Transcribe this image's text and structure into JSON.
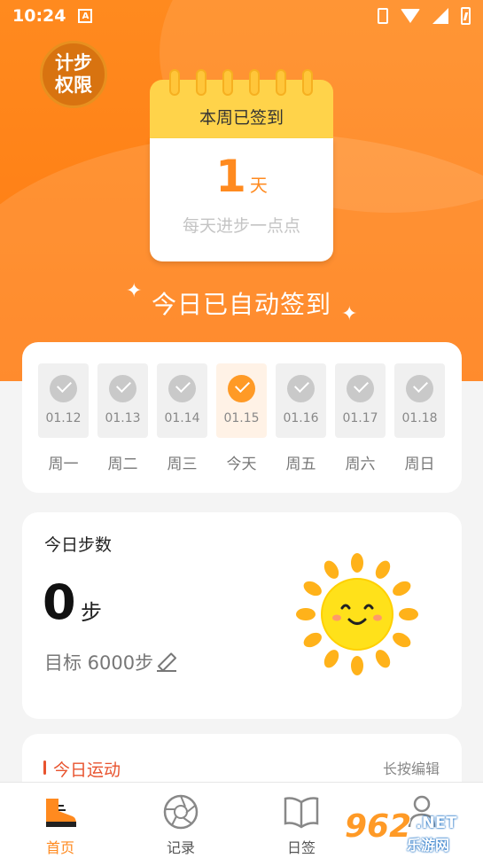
{
  "status_bar": {
    "time": "10:24",
    "notification_glyph": "A"
  },
  "permission_badge": {
    "label": "计步权限"
  },
  "calendar": {
    "title": "本周已签到",
    "days_count": "1",
    "days_unit": "天",
    "subtitle": "每天进步一点点"
  },
  "auto_checkin_text": "今日已自动签到",
  "week": {
    "days": [
      {
        "date": "01.12",
        "label": "周一",
        "checked": true,
        "today": false
      },
      {
        "date": "01.13",
        "label": "周二",
        "checked": true,
        "today": false
      },
      {
        "date": "01.14",
        "label": "周三",
        "checked": true,
        "today": false
      },
      {
        "date": "01.15",
        "label": "今天",
        "checked": true,
        "today": true
      },
      {
        "date": "01.16",
        "label": "周五",
        "checked": true,
        "today": false
      },
      {
        "date": "01.17",
        "label": "周六",
        "checked": true,
        "today": false
      },
      {
        "date": "01.18",
        "label": "周日",
        "checked": true,
        "today": false
      }
    ]
  },
  "steps": {
    "title": "今日步数",
    "count": "0",
    "unit": "步",
    "goal_text": "目标 6000步"
  },
  "exercise": {
    "title": "今日运动",
    "edit_hint": "长按编辑"
  },
  "nav": {
    "items": [
      {
        "label": "首页",
        "icon": "shoe-icon",
        "active": true
      },
      {
        "label": "记录",
        "icon": "aperture-icon",
        "active": false
      },
      {
        "label": "日签",
        "icon": "book-icon",
        "active": false
      },
      {
        "label": "",
        "icon": "user-icon",
        "active": false
      }
    ]
  },
  "watermark": {
    "brand": "962",
    "domain": ".NET",
    "tagline": "乐游网"
  },
  "colors": {
    "accent": "#ff8a1f",
    "card": "#ffffff",
    "background": "#f4f4f4",
    "sun": "#ffe11a"
  }
}
